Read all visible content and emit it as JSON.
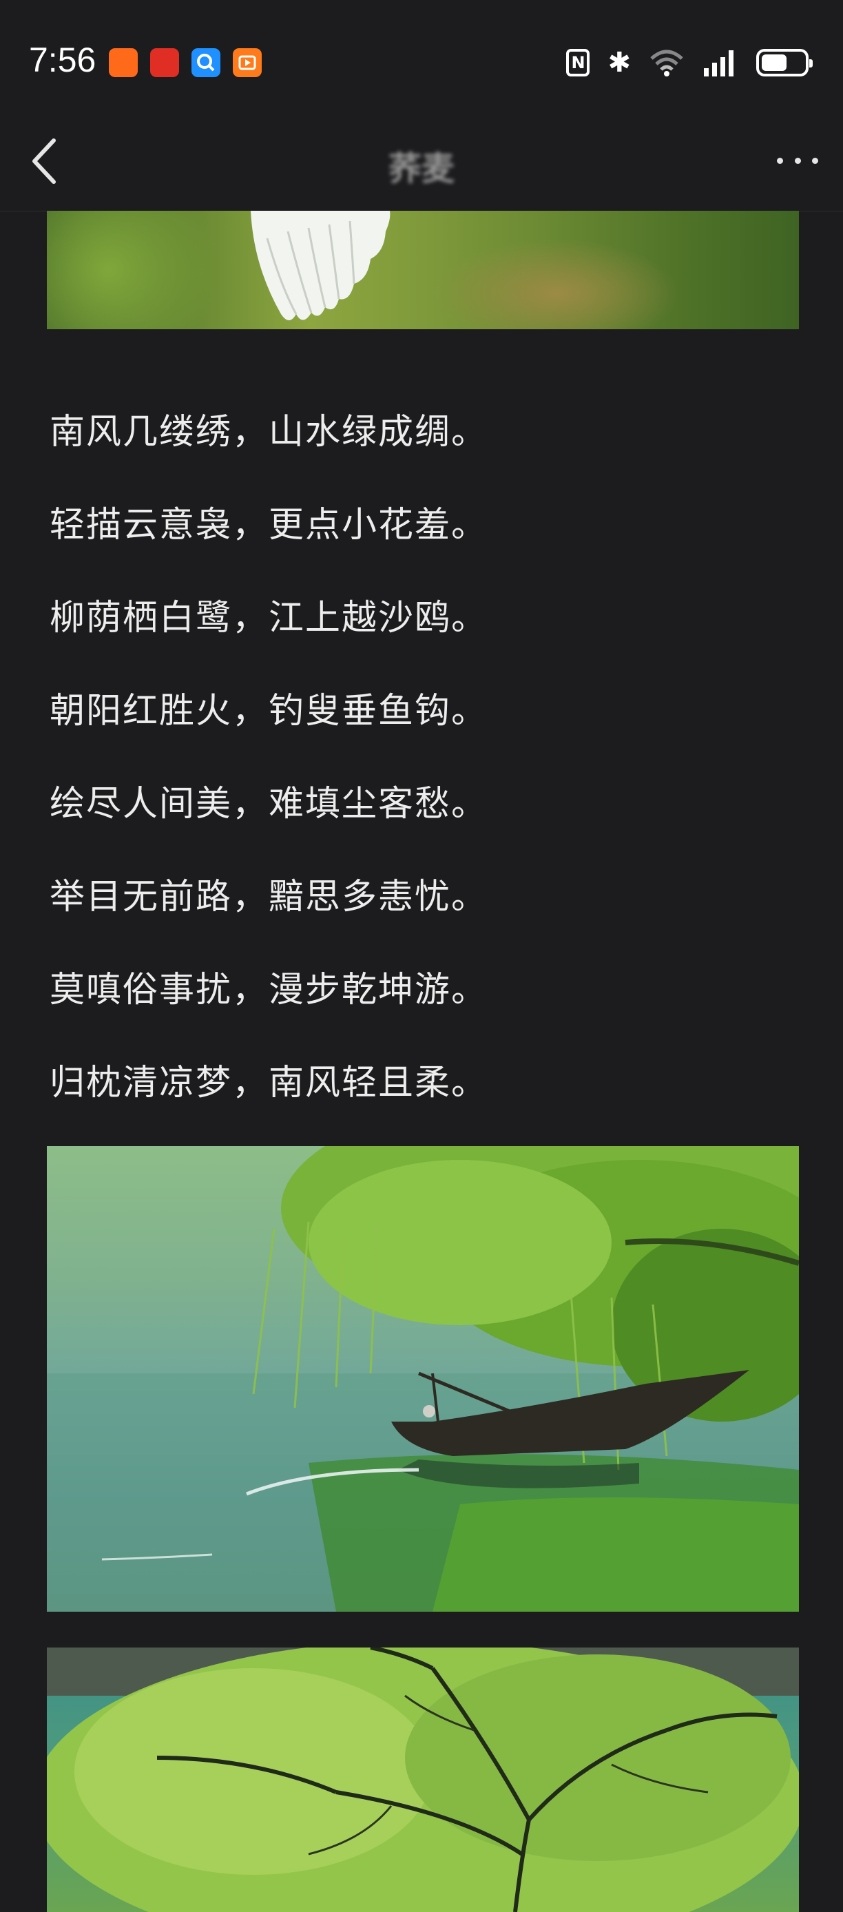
{
  "status_bar": {
    "time": "7:56",
    "app_icons": [
      {
        "name": "taobao-app-icon",
        "color": "#ff6a1a"
      },
      {
        "name": "pinduoduo-app-icon",
        "color": "#e02e24"
      },
      {
        "name": "browser-app-icon",
        "color": "#1e90ff"
      },
      {
        "name": "video-app-icon",
        "color": "#ff7a1a"
      }
    ],
    "nfc_label": "N",
    "bluetooth_glyph": "✱",
    "battery_level": 0.6
  },
  "nav": {
    "title": "荞麦"
  },
  "poem": {
    "lines": [
      "南风几缕绣，山水绿成绸。",
      "轻描云意袅，更点小花羞。",
      "柳荫栖白鹭，江上越沙鸥。",
      "朝阳红胜火，钓叟垂鱼钩。",
      "绘尽人间美，难填尘客愁。",
      "举目无前路，黯思多恚忧。",
      "莫嗔俗事扰，漫步乾坤游。",
      "归枕清凉梦，南风轻且柔。"
    ]
  }
}
